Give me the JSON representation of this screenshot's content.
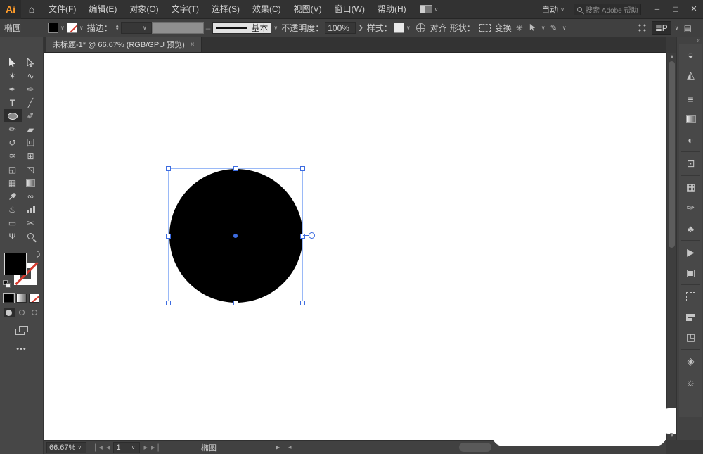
{
  "titlebar": {
    "app_logo": "Ai",
    "menus": [
      "文件(F)",
      "编辑(E)",
      "对象(O)",
      "文字(T)",
      "选择(S)",
      "效果(C)",
      "视图(V)",
      "窗口(W)",
      "帮助(H)"
    ],
    "workspace_label": "自动",
    "search_placeholder": "搜索 Adobe 帮助"
  },
  "controlbar": {
    "tool_label": "椭圆",
    "stroke_label": "描边：",
    "brush_label": "基本",
    "opacity_label": "不透明度：",
    "opacity_value": "100%",
    "style_label": "样式：",
    "align_label": "对齐",
    "shape_label": "形状：",
    "transform_label": "变换"
  },
  "tabbar": {
    "doc_title": "未标题-1* @ 66.67% (RGB/GPU 预览)",
    "close": "×"
  },
  "statusbar": {
    "zoom_value": "66.67%",
    "artboard_number": "1",
    "current_tool": "椭圆"
  },
  "canvas": {
    "shape_type": "ellipse",
    "shape_fill": "#000000",
    "selection_accent": "#3d6ce0",
    "bounding_box_color": "#9ab9f7"
  },
  "colors": {
    "ui_dark": "#323232",
    "panel": "#474747",
    "none_slash_red": "#d63b2f",
    "logo_orange": "#ff9c2a"
  }
}
